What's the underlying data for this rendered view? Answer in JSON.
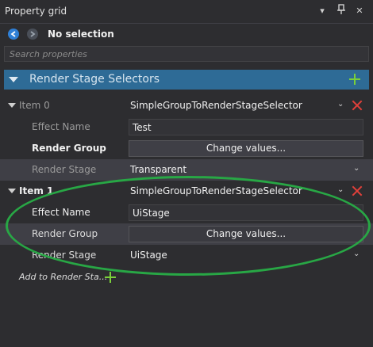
{
  "window": {
    "title": "Property grid",
    "controls": [
      "dropdown-icon",
      "pin-icon",
      "close-icon"
    ]
  },
  "toolbar": {
    "back_icon": "arrow-left-icon",
    "forward_icon": "arrow-right-icon",
    "selection_label": "No selection"
  },
  "search": {
    "placeholder": "Search properties",
    "value": ""
  },
  "section": {
    "title": "Render Stage Selectors",
    "add_icon": "plus-icon"
  },
  "items": [
    {
      "header": "Item 0",
      "type": "SimpleGroupToRenderStageSelector",
      "effect_name_label": "Effect Name",
      "effect_name_value": "Test",
      "render_group_label": "Render Group",
      "render_group_button": "Change values...",
      "render_stage_label": "Render Stage",
      "render_stage_value": "Transparent"
    },
    {
      "header": "Item 1",
      "type": "SimpleGroupToRenderStageSelector",
      "effect_name_label": "Effect Name",
      "effect_name_value": "UiStage",
      "render_group_label": "Render Group",
      "render_group_button": "Change values...",
      "render_stage_label": "Render Stage",
      "render_stage_value": "UiStage"
    }
  ],
  "add_link": "Add to Render Sta...",
  "colors": {
    "background": "#2d2d30",
    "section_header": "#2e6b96",
    "add_green": "#7ad03a",
    "remove_red": "#e2403a",
    "annotation_green": "#28a745"
  }
}
